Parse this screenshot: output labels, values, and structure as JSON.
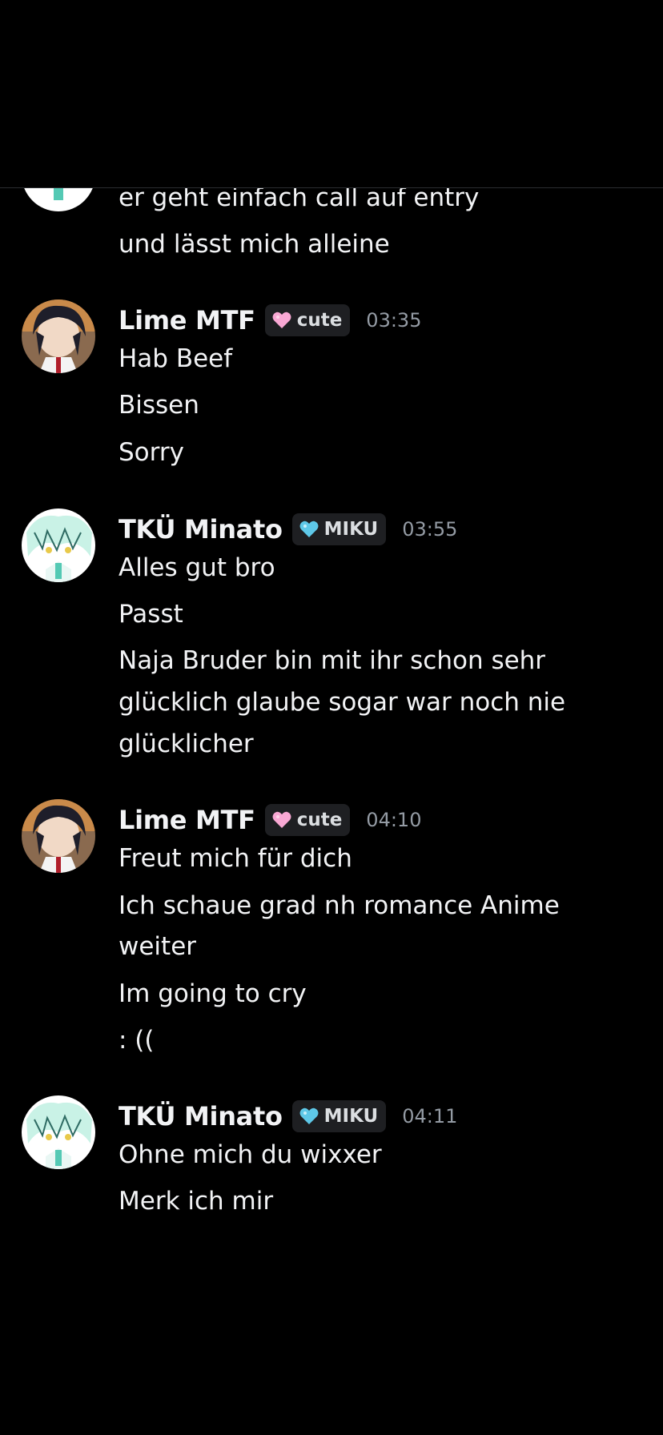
{
  "groups": [
    {
      "author": "",
      "lines": [
        "er geht einfach call auf entry",
        "und lässt mich alleine"
      ]
    },
    {
      "author": "Lime MTF",
      "role": {
        "icon": "pink-heart-icon",
        "label": "cute",
        "color": "#f9a8d4"
      },
      "time": "03:35",
      "lines": [
        "Hab Beef",
        "Bissen",
        "Sorry"
      ]
    },
    {
      "author": "TKÜ Minato",
      "role": {
        "icon": "blue-heart-icon",
        "label": "MIKU",
        "color": "#5ec8e8"
      },
      "time": "03:55",
      "lines": [
        "Alles gut bro",
        "Passt",
        "Naja Bruder bin mit ihr schon sehr",
        "glücklich glaube sogar war noch nie",
        "glücklicher"
      ]
    },
    {
      "author": "Lime MTF",
      "role": {
        "icon": "pink-heart-icon",
        "label": "cute",
        "color": "#f9a8d4"
      },
      "time": "04:10",
      "lines": [
        "Freut mich für dich",
        "Ich schaue grad nh romance Anime",
        "weiter",
        "Im going to cry",
        ": (("
      ]
    },
    {
      "author": "TKÜ Minato",
      "role": {
        "icon": "blue-heart-icon",
        "label": "MIKU",
        "color": "#5ec8e8"
      },
      "time": "04:11",
      "lines": [
        "Ohne mich du wixxer",
        "Merk ich mir"
      ]
    }
  ]
}
